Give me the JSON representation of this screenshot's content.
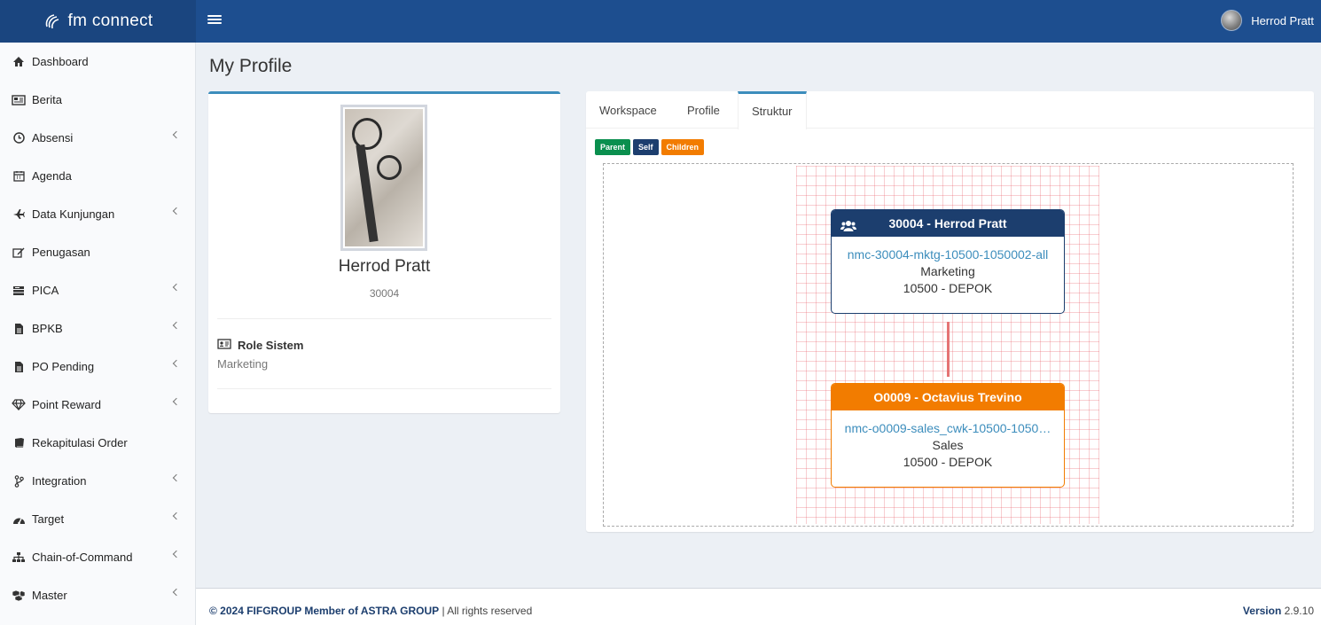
{
  "app": {
    "brand": "fm connect",
    "user_name": "Herrod Pratt",
    "accent_color": "#1d4e8f"
  },
  "sidebar": {
    "items": [
      {
        "label": "Dashboard",
        "icon": "home-icon",
        "has_submenu": false
      },
      {
        "label": "Berita",
        "icon": "newspaper-icon",
        "has_submenu": false
      },
      {
        "label": "Absensi",
        "icon": "clock-icon",
        "has_submenu": true
      },
      {
        "label": "Agenda",
        "icon": "calendar-icon",
        "has_submenu": false
      },
      {
        "label": "Data Kunjungan",
        "icon": "plane-icon",
        "has_submenu": true
      },
      {
        "label": "Penugasan",
        "icon": "edit-icon",
        "has_submenu": false
      },
      {
        "label": "PICA",
        "icon": "list-icon",
        "has_submenu": true
      },
      {
        "label": "BPKB",
        "icon": "file-icon",
        "has_submenu": true
      },
      {
        "label": "PO Pending",
        "icon": "file-icon",
        "has_submenu": true
      },
      {
        "label": "Point Reward",
        "icon": "diamond-icon",
        "has_submenu": true
      },
      {
        "label": "Rekapitulasi Order",
        "icon": "book-icon",
        "has_submenu": false
      },
      {
        "label": "Integration",
        "icon": "branch-icon",
        "has_submenu": true
      },
      {
        "label": "Target",
        "icon": "gauge-icon",
        "has_submenu": true
      },
      {
        "label": "Chain-of-Command",
        "icon": "sitemap-icon",
        "has_submenu": true
      },
      {
        "label": "Master",
        "icon": "cubes-icon",
        "has_submenu": true
      }
    ]
  },
  "page": {
    "title": "My Profile"
  },
  "profile": {
    "name": "Herrod Pratt",
    "employee_id": "30004",
    "role_label": "Role Sistem",
    "role_value": "Marketing"
  },
  "tabs": [
    {
      "label": "Workspace",
      "active": false
    },
    {
      "label": "Profile",
      "active": false
    },
    {
      "label": "Struktur",
      "active": true
    }
  ],
  "legend": {
    "parent": "Parent",
    "self": "Self",
    "children": "Children"
  },
  "org": {
    "self": {
      "title": "30004 - Herrod Pratt",
      "code": "nmc-30004-mktg-10500-1050002-all",
      "department": "Marketing",
      "branch": "10500 - DEPOK",
      "color": "#1c3e6e"
    },
    "child": {
      "title": "O0009 - Octavius Trevino",
      "code": "nmc-o0009-sales_cwk-10500-1050…",
      "department": "Sales",
      "branch": "10500 - DEPOK",
      "color": "#f27c00"
    }
  },
  "footer": {
    "copyright": "© 2024 FIFGROUP Member of ASTRA GROUP",
    "rights": " | All rights reserved",
    "version_label": "Version",
    "version_number": "2.9.10"
  }
}
